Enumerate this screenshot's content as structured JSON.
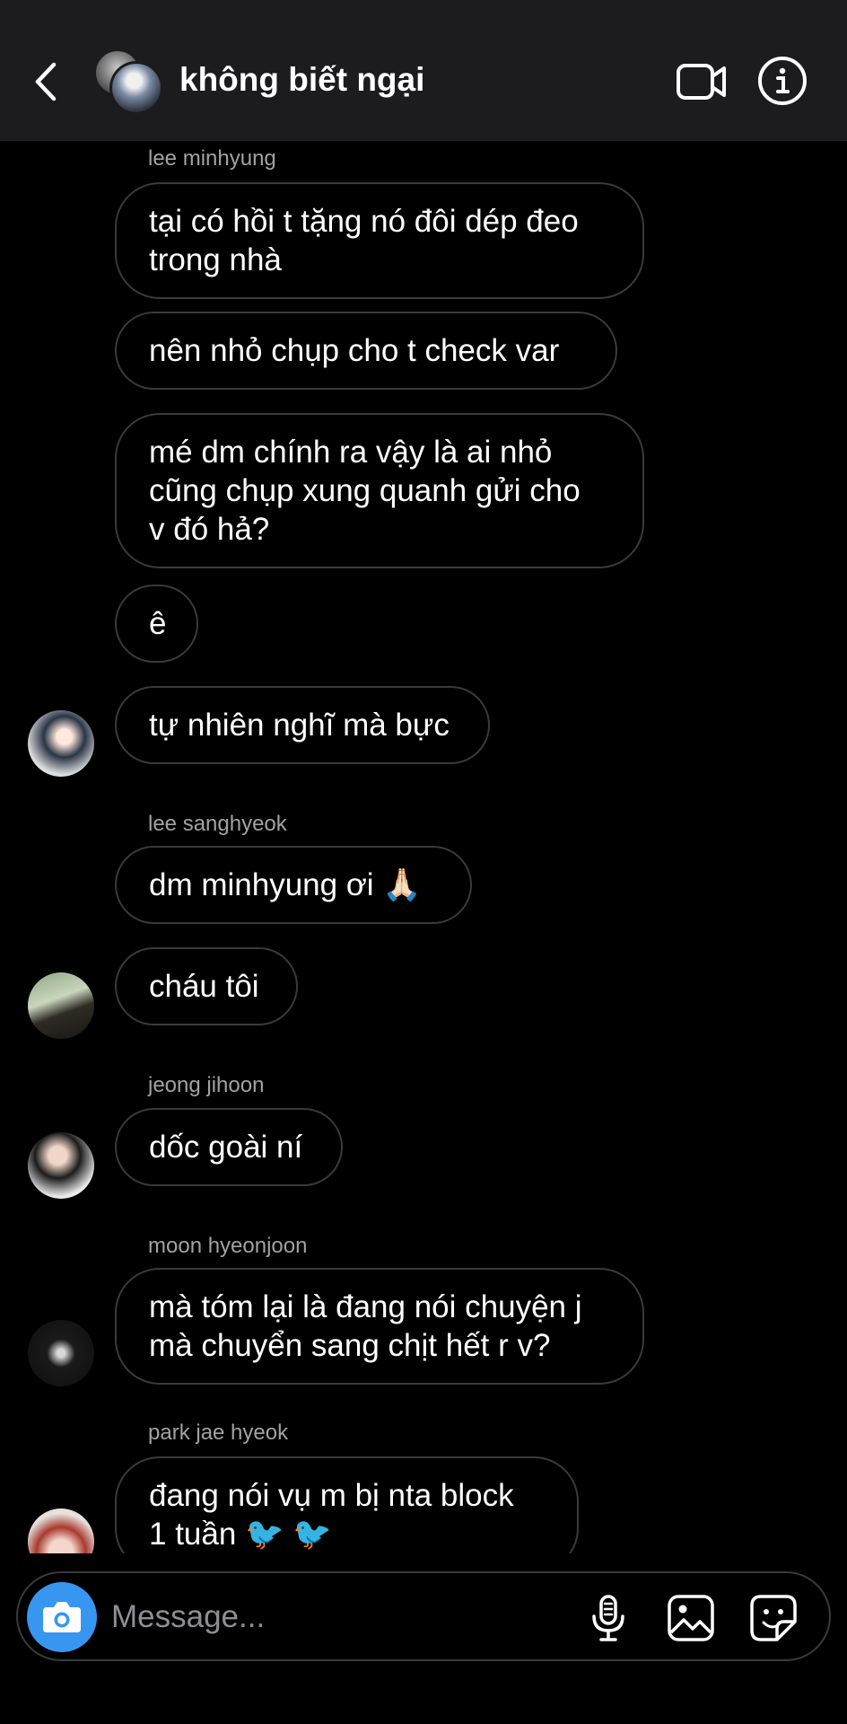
{
  "header": {
    "title": "không biết ngại",
    "back_icon": "chevron-left-icon",
    "video_icon": "video-camera-icon",
    "info_icon": "info-circle-icon"
  },
  "messages": [
    {
      "type": "sender",
      "text": "lee minhyung"
    },
    {
      "type": "bubble",
      "text": "tại có hồi t tặng nó đôi dép đeo\ntrong nhà"
    },
    {
      "type": "bubble",
      "text": "nên nhỏ chụp cho t check var"
    },
    {
      "type": "bubble",
      "text": "mé dm chính ra vậy là ai nhỏ\ncũng chụp xung quanh gửi cho\nv đó hả?"
    },
    {
      "type": "bubble",
      "text": "ê"
    },
    {
      "type": "bubble",
      "text": "tự nhiên nghĩ mà bực"
    },
    {
      "type": "sender",
      "text": "lee sanghyeok"
    },
    {
      "type": "bubble",
      "text": "dm minhyung ơi 🙏🏻"
    },
    {
      "type": "bubble",
      "text": "cháu tôi"
    },
    {
      "type": "sender",
      "text": "jeong jihoon"
    },
    {
      "type": "bubble",
      "text": "dốc goài ní"
    },
    {
      "type": "sender",
      "text": "moon hyeonjoon"
    },
    {
      "type": "bubble",
      "text": "mà tóm lại là đang nói chuyện j\nmà chuyển sang chịt hết r v?"
    },
    {
      "type": "sender",
      "text": "park jae hyeok"
    },
    {
      "type": "bubble",
      "text": "đang nói vụ m bị nta block\n1 tuần 🐦 🐦"
    }
  ],
  "composer": {
    "placeholder": "Message...",
    "camera_icon": "camera-icon",
    "mic_icon": "microphone-icon",
    "gallery_icon": "image-gallery-icon",
    "sticker_icon": "sticker-icon"
  },
  "colors": {
    "background": "#000000",
    "header_bg": "#1c1c1e",
    "bubble_border": "#3a3a3c",
    "sender_text": "#a2a2a2",
    "accent": "#3797f0"
  }
}
